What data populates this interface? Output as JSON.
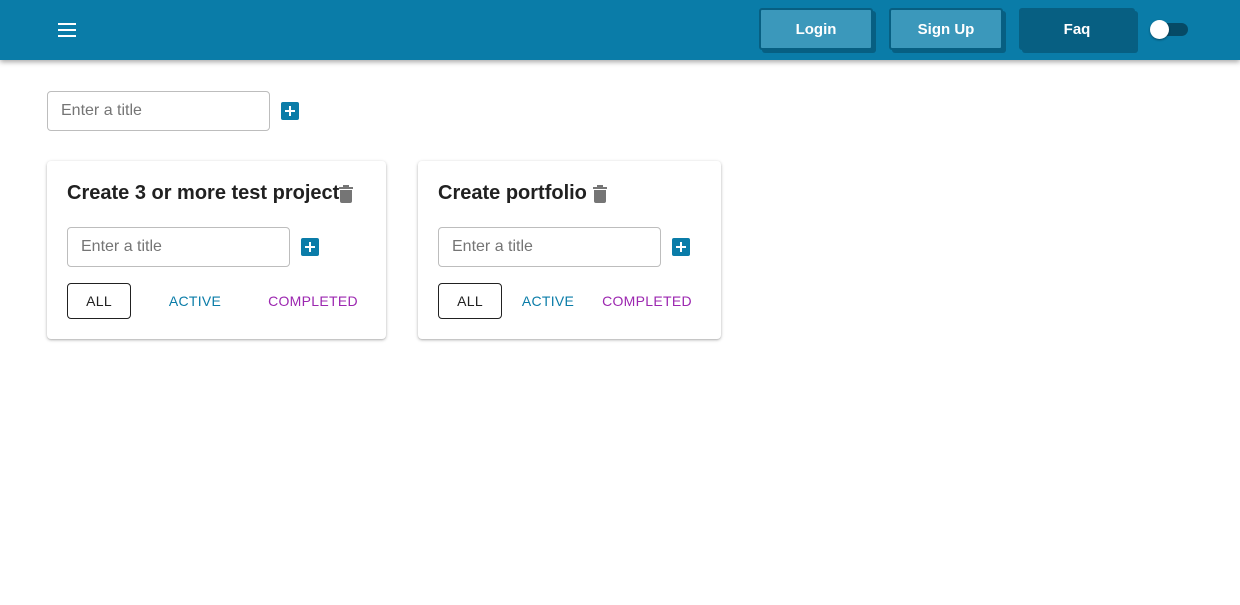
{
  "header": {
    "menu_icon": "menu-icon",
    "login_label": "Login",
    "signup_label": "Sign Up",
    "faq_label": "Faq",
    "theme_toggle_on": false
  },
  "new_todolist": {
    "placeholder": "Enter a title",
    "add_icon": "plus-box-icon"
  },
  "todolists": [
    {
      "title": "Create 3 or more test project",
      "delete_icon": "trash-icon",
      "input_placeholder": "Enter a title",
      "filters": {
        "all": "ALL",
        "active": "ACTIVE",
        "completed": "COMPLETED"
      },
      "selected_filter": "ALL"
    },
    {
      "title": "Create portfolio",
      "delete_icon": "trash-icon",
      "input_placeholder": "Enter a title",
      "filters": {
        "all": "ALL",
        "active": "ACTIVE",
        "completed": "COMPLETED"
      },
      "selected_filter": "ALL"
    }
  ],
  "colors": {
    "primary": "#0a7ca8",
    "primary_dark": "#075f82",
    "button_light": "#3b98bb",
    "completed": "#9c27b0"
  }
}
